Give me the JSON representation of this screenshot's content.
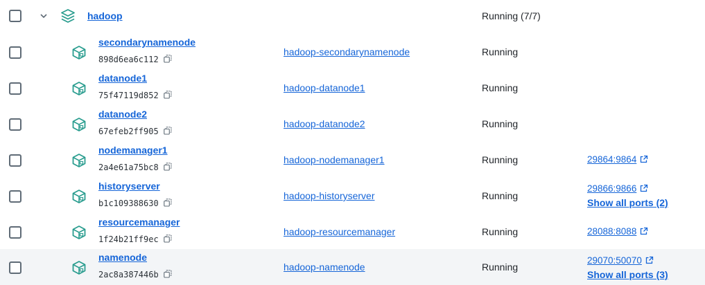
{
  "group": {
    "name": "hadoop",
    "status": "Running (7/7)"
  },
  "containers": [
    {
      "name": "secondarynamenode",
      "id": "898d6ea6c112",
      "image": "hadoop-secondarynamenode",
      "status": "Running"
    },
    {
      "name": "datanode1",
      "id": "75f47119d852",
      "image": "hadoop-datanode1",
      "status": "Running"
    },
    {
      "name": "datanode2",
      "id": "67efeb2ff905",
      "image": "hadoop-datanode2",
      "status": "Running"
    },
    {
      "name": "nodemanager1",
      "id": "2a4e61a75bc8",
      "image": "hadoop-nodemanager1",
      "status": "Running",
      "port": "29864:9864"
    },
    {
      "name": "historyserver",
      "id": "b1c109388630",
      "image": "hadoop-historyserver",
      "status": "Running",
      "port": "29866:9866",
      "show_all": "Show all ports (2)"
    },
    {
      "name": "resourcemanager",
      "id": "1f24b21ff9ec",
      "image": "hadoop-resourcemanager",
      "status": "Running",
      "port": "28088:8088"
    },
    {
      "name": "namenode",
      "id": "2ac8a387446b",
      "image": "hadoop-namenode",
      "status": "Running",
      "port": "29070:50070",
      "show_all": "Show all ports (3)"
    }
  ],
  "colors": {
    "accent": "#1565d8",
    "icon": "#2a9d8f",
    "highlight_row": "#f3f5f7"
  },
  "icons": {
    "expand": "chevron-down-icon",
    "group": "stack-layers-icon",
    "container": "container-cube-icon",
    "copy": "copy-icon",
    "external": "external-link-icon"
  }
}
